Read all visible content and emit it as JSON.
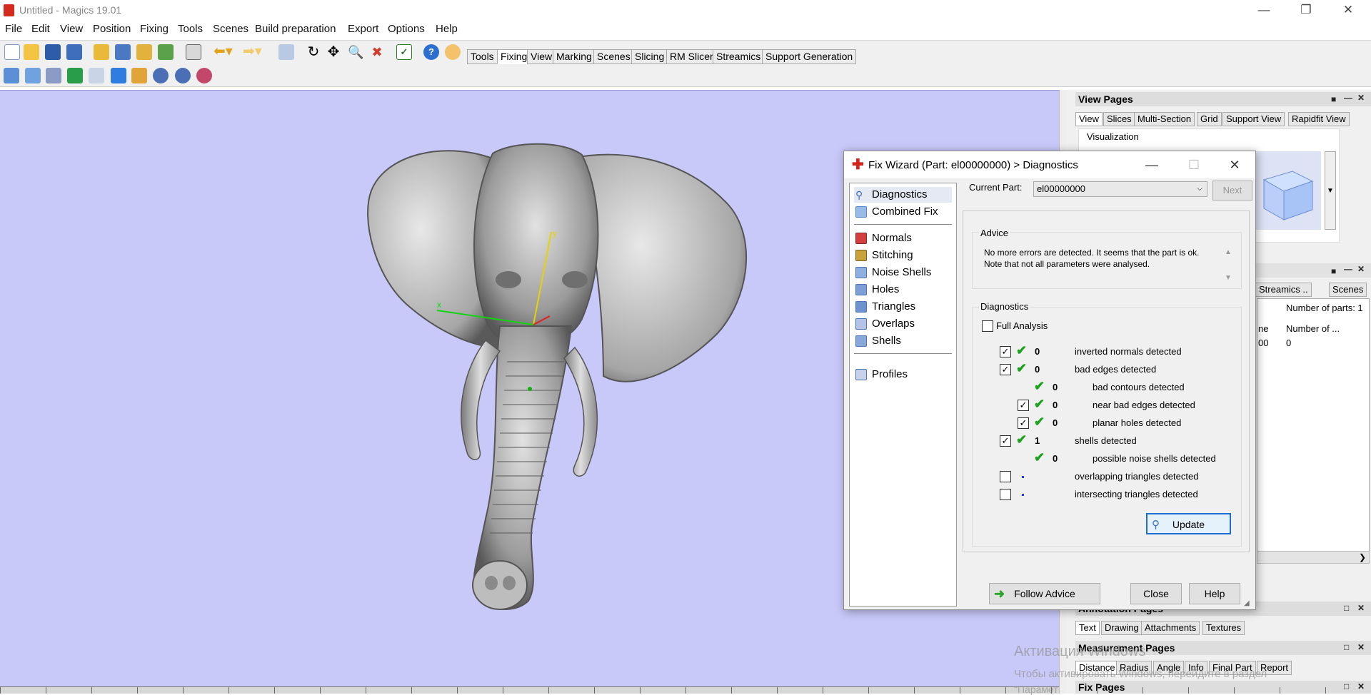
{
  "app": {
    "title": "Untitled - Magics 19.01",
    "window_controls": [
      "minimize",
      "restore",
      "close"
    ]
  },
  "menu": [
    "File",
    "Edit",
    "View",
    "Position",
    "Fixing",
    "Tools",
    "Scenes",
    "Build preparation",
    "Export",
    "Options",
    "Help"
  ],
  "toolbar_tabs": [
    "Tools",
    "Fixing",
    "View",
    "Marking",
    "Scenes",
    "Slicing",
    "RM Slicer",
    "Streamics",
    "Support Generation"
  ],
  "toolbar_active_tab": "Fixing",
  "viewport": {
    "background": "#c8c8f9",
    "model": "elephant head relief",
    "axes": {
      "x": "x",
      "y": "y"
    }
  },
  "right_panel": {
    "view_pages": {
      "title": "View Pages",
      "tabs": [
        "View",
        "Slices",
        "Multi-Section",
        "Grid",
        "Support View",
        "Rapidfit View"
      ],
      "active": "View",
      "group": "Visualization"
    },
    "parts_panel": {
      "tabs": [
        "Streamics ..",
        "Scenes"
      ],
      "count_label": "Number of parts: 1",
      "columns": [
        "ne",
        "Number of ..."
      ],
      "row": [
        "00",
        "0"
      ]
    },
    "annotation_pages": {
      "title": "Annotation Pages",
      "tabs": [
        "Text",
        "Drawing",
        "Attachments",
        "Textures"
      ],
      "active": "Text"
    },
    "measurement_pages": {
      "title": "Measurement Pages",
      "tabs": [
        "Distance",
        "Radius",
        "Angle",
        "Info",
        "Final Part",
        "Report"
      ],
      "active": "Distance"
    },
    "fix_pages": {
      "title": "Fix Pages"
    }
  },
  "watermark": {
    "line1": "Активация Windows",
    "line2": "Чтобы активировать Windows, перейдите в раздел",
    "line3": "\"Парамет"
  },
  "dialog": {
    "title": "Fix Wizard (Part: el00000000) > Diagnostics",
    "nav": [
      {
        "label": "Diagnostics",
        "icon": "magnifier-icon",
        "selected": true
      },
      {
        "label": "Combined Fix",
        "icon": "cube-icon"
      },
      {
        "label": "Normals",
        "icon": "normals-icon"
      },
      {
        "label": "Stitching",
        "icon": "stitching-icon"
      },
      {
        "label": "Noise Shells",
        "icon": "noise-shells-icon"
      },
      {
        "label": "Holes",
        "icon": "holes-icon"
      },
      {
        "label": "Triangles",
        "icon": "triangles-icon"
      },
      {
        "label": "Overlaps",
        "icon": "overlaps-icon"
      },
      {
        "label": "Shells",
        "icon": "shells-icon"
      },
      {
        "label": "Profiles",
        "icon": "profiles-icon"
      }
    ],
    "current_part_label": "Current Part:",
    "current_part_value": "el00000000",
    "next_label": "Next",
    "advice_title": "Advice",
    "advice_text": "No more errors are detected. It seems that the part is ok. Note that not all parameters were analysed.",
    "diagnostics_title": "Diagnostics",
    "full_analysis_label": "Full Analysis",
    "rows": [
      {
        "checked": true,
        "status": "ok",
        "count": "0",
        "label": "inverted normals detected",
        "indent": 0
      },
      {
        "checked": true,
        "status": "ok",
        "count": "0",
        "label": "bad edges detected",
        "indent": 0
      },
      {
        "checkbox": false,
        "status": "ok",
        "count": "0",
        "label": "bad contours detected",
        "indent": 1
      },
      {
        "checked": true,
        "status": "ok",
        "count": "0",
        "label": "near bad edges detected",
        "indent": 1
      },
      {
        "checked": true,
        "status": "ok",
        "count": "0",
        "label": "planar holes detected",
        "indent": 1
      },
      {
        "checked": true,
        "status": "ok",
        "count": "1",
        "label": "shells detected",
        "indent": 0
      },
      {
        "checkbox": false,
        "status": "ok",
        "count": "0",
        "label": "possible noise shells detected",
        "indent": 1
      },
      {
        "checked": false,
        "status": "dot",
        "count": "",
        "label": "overlapping triangles detected",
        "indent": 0
      },
      {
        "checked": false,
        "status": "dot",
        "count": "",
        "label": "intersecting triangles detected",
        "indent": 0
      }
    ],
    "update_label": "Update",
    "follow_advice_label": "Follow Advice",
    "close_label": "Close",
    "help_label": "Help"
  }
}
